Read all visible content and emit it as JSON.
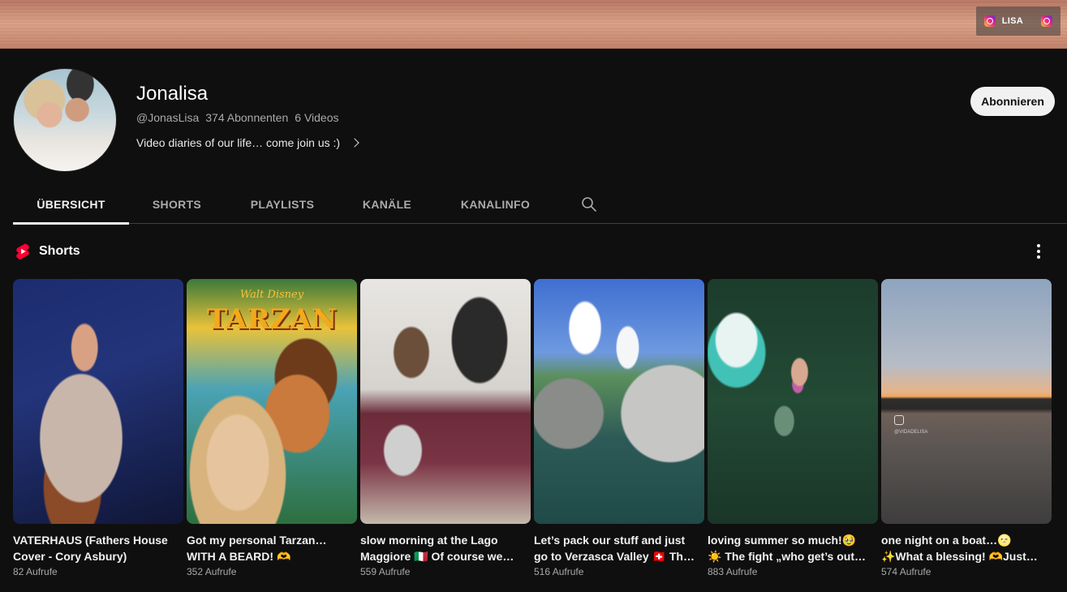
{
  "banner": {
    "link_label": "LISA",
    "link_icon": "instagram-icon"
  },
  "channel": {
    "name": "Jonalisa",
    "handle": "@JonasLisa",
    "subscribers": "374 Abonnenten",
    "videos": "6 Videos",
    "description": "Video diaries of our life… come join us :)",
    "subscribe_label": "Abonnieren"
  },
  "tabs": [
    {
      "label": "ÜBERSICHT",
      "active": true
    },
    {
      "label": "SHORTS",
      "active": false
    },
    {
      "label": "PLAYLISTS",
      "active": false
    },
    {
      "label": "KANÄLE",
      "active": false
    },
    {
      "label": "KANALINFO",
      "active": false
    }
  ],
  "shorts": {
    "section_title": "Shorts",
    "items": [
      {
        "title": "VATERHAUS (Fathers House Cover - Cory Asbury)",
        "views": "82 Aufrufe"
      },
      {
        "title": "Got my personal Tarzan… WITH A BEARD! 🫶",
        "views": "352 Aufrufe"
      },
      {
        "title": "slow morning at the Lago Maggiore 🇮🇹 Of course we…",
        "views": "559 Aufrufe"
      },
      {
        "title": "Let’s pack our stuff and just go to Verzasca Valley 🇨🇭 Th…",
        "views": "516 Aufrufe"
      },
      {
        "title": "loving summer so much!🥹 ☀️ The fight „who get’s out…",
        "views": "883 Aufrufe"
      },
      {
        "title": "one night on a boat…🌝 ✨What a blessing! 🫶Just…",
        "views": "574 Aufrufe"
      }
    ]
  },
  "thumbnail_texts": {
    "tarzan_logo_top": "Walt Disney",
    "tarzan_logo": "TARZAN",
    "boat_watermark": "@VIDADELISA"
  },
  "colors": {
    "background": "#0f0f0f",
    "shorts_red": "#ff0033",
    "subscribe_bg": "#f1f1f1"
  }
}
